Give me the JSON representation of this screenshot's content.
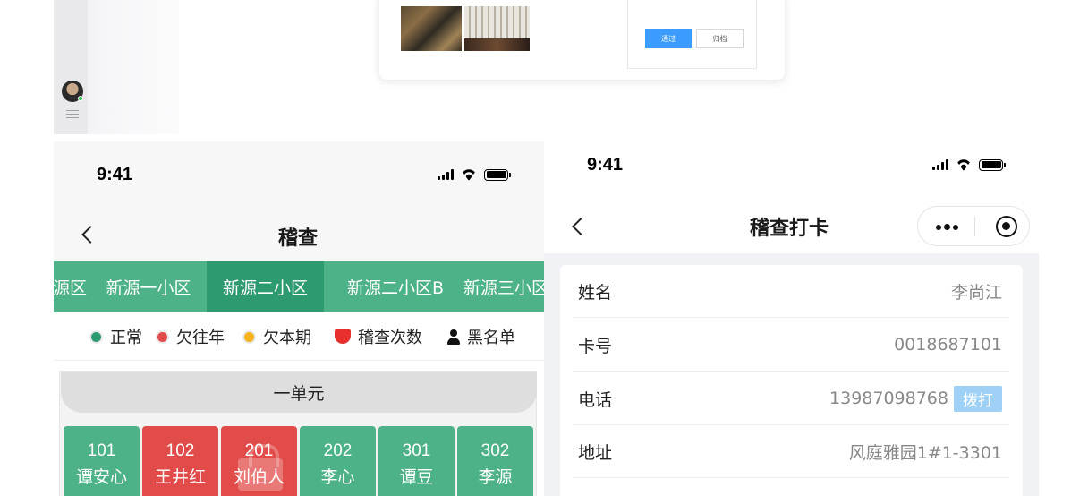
{
  "admin_panel": {
    "buttons": {
      "pass": "通过",
      "archive": "归档"
    }
  },
  "left_phone": {
    "status_time": "9:41",
    "title": "稽查",
    "tabs": [
      "源区",
      "新源一小区",
      "新源二小区",
      "新源二小区B",
      "新源三小区"
    ],
    "active_tab": "新源二小区",
    "legend": [
      {
        "label": "正常",
        "color": "#2e9a70"
      },
      {
        "label": "欠往年",
        "color": "#e14c4a"
      },
      {
        "label": "欠本期",
        "color": "#f5b21b"
      },
      {
        "label": "稽查次数",
        "icon": "red-cup-icon"
      },
      {
        "label": "黑名单",
        "icon": "person-icon"
      }
    ],
    "unit": {
      "title": "一单元",
      "rooms": [
        {
          "number": "101",
          "name": "谭安心",
          "status": "normal"
        },
        {
          "number": "102",
          "name": "王井红",
          "status": "owe"
        },
        {
          "number": "201",
          "name": "刘伯人",
          "status": "owe",
          "locked": true
        },
        {
          "number": "202",
          "name": "李心",
          "status": "normal"
        },
        {
          "number": "301",
          "name": "谭豆",
          "status": "normal"
        },
        {
          "number": "302",
          "name": "李源",
          "status": "normal"
        }
      ]
    }
  },
  "right_phone": {
    "status_time": "9:41",
    "title": "稽查打卡",
    "fields": [
      {
        "label": "姓名",
        "value": "李尚江"
      },
      {
        "label": "卡号",
        "value": "0018687101"
      },
      {
        "label": "电话",
        "value": "13987098768",
        "action": "拨打"
      },
      {
        "label": "地址",
        "value": "风庭雅园1#1-3301"
      }
    ]
  }
}
